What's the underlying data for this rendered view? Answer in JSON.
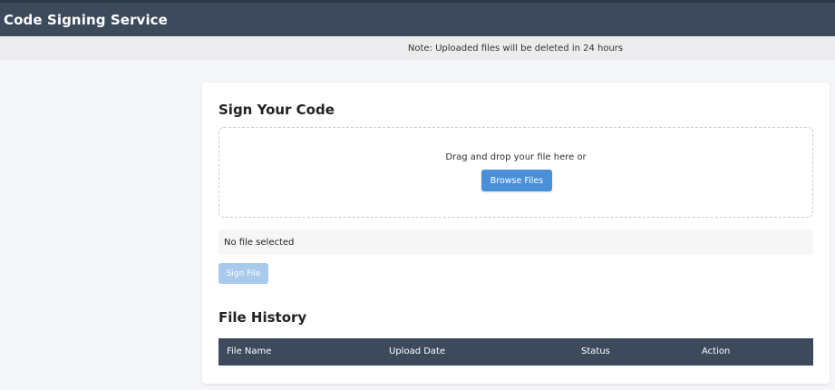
{
  "header": {
    "title": "Code Signing Service"
  },
  "notice": {
    "text": "Note: Uploaded files will be deleted in 24 hours"
  },
  "sign_card": {
    "title": "Sign Your Code",
    "dropzone": {
      "text": "Drag and drop your file here or",
      "browse_label": "Browse Files"
    },
    "file_status": "No file selected",
    "sign_label": "Sign File",
    "sign_enabled": false
  },
  "history": {
    "title": "File History",
    "columns": [
      "File Name",
      "Upload Date",
      "Status",
      "Action"
    ],
    "rows": []
  },
  "colors": {
    "header_bg": "#3d4a5c",
    "primary_button": "#4a90d9",
    "disabled_button": "#a8cbed",
    "page_bg": "#f5f6f8"
  }
}
